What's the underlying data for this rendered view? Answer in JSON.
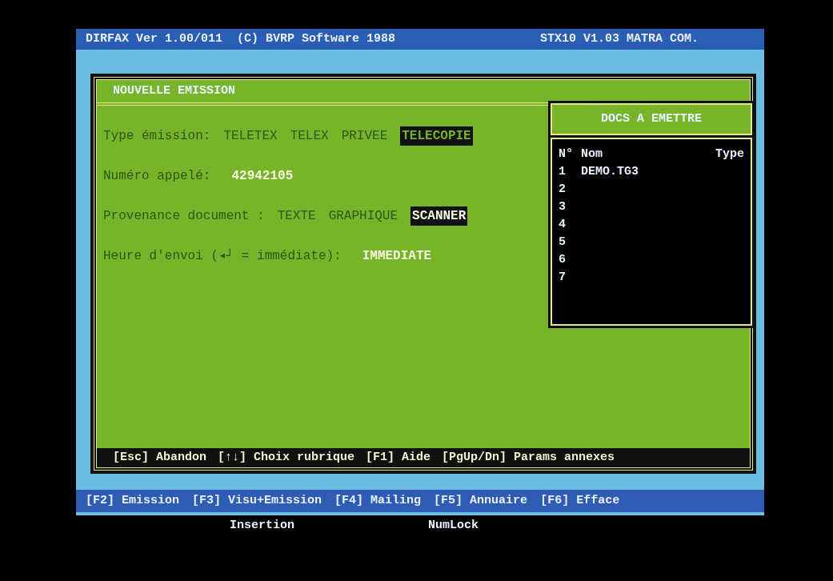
{
  "title_bar": {
    "left": "DIRFAX Ver 1.00/011  (C) BVRP Software 1988",
    "right": "STX10 V1.03 MATRA COM."
  },
  "dialog": {
    "title": "NOUVELLE EMISSION",
    "fields": [
      {
        "kind": "options",
        "label": "Type émission:",
        "options": [
          {
            "label": "TELETEX",
            "selected": false
          },
          {
            "label": "TELEX",
            "selected": false
          },
          {
            "label": "PRIVEE",
            "selected": false
          },
          {
            "label": "TELECOPIE",
            "selected": true
          }
        ]
      },
      {
        "kind": "value",
        "label": "Numéro appelé:",
        "value": "42942105"
      },
      {
        "kind": "options",
        "label": "Provenance document :",
        "options": [
          {
            "label": "TEXTE",
            "selected": false
          },
          {
            "label": "GRAPHIQUE",
            "selected": false
          },
          {
            "label": "SCANNER",
            "selected": true
          }
        ]
      },
      {
        "kind": "value",
        "label": "Heure d'envoi (◂┘ = immédiate):",
        "value": "IMMEDIATE"
      }
    ],
    "hints": [
      "[Esc] Abandon",
      "[↑↓] Choix rubrique",
      "[F1] Aide",
      "[PgUp/Dn] Params annexes"
    ]
  },
  "docs_panel": {
    "title": "DOCS A EMETTRE",
    "columns": [
      "N°",
      "Nom",
      "Type"
    ],
    "rows": [
      {
        "number": "1",
        "name": "DEMO.TG3"
      },
      {
        "number": "2"
      },
      {
        "number": "3"
      },
      {
        "number": "4"
      },
      {
        "number": "5"
      },
      {
        "number": "6"
      },
      {
        "number": "7"
      }
    ]
  },
  "function_keys": [
    "[F2] Emission",
    "[F3] Visu+Emission",
    "[F4] Mailing",
    "[F5] Annuaire",
    "[F6] Efface"
  ],
  "status": [
    "Insertion",
    "NumLock"
  ]
}
